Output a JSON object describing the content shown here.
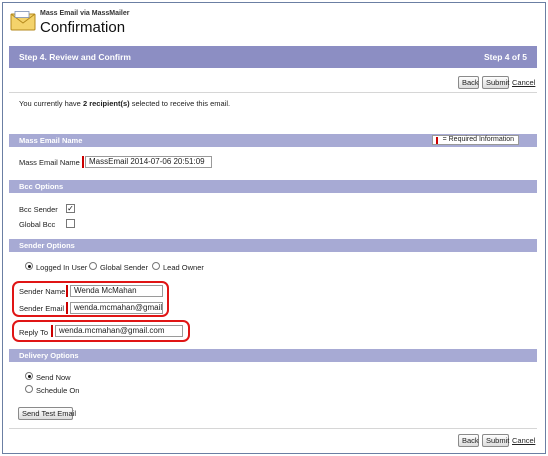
{
  "header": {
    "subtitle": "Mass Email via MassMailer",
    "title": "Confirmation",
    "icon": "envelope-icon"
  },
  "stepbar": {
    "title": "Step 4. Review and Confirm",
    "count": "Step 4 of 5"
  },
  "buttons": {
    "back": "Back",
    "submit": "Submit",
    "cancel": "Cancel",
    "send_test": "Send Test Email"
  },
  "info": {
    "prefix": "You currently have ",
    "count": "2 recipient(s)",
    "suffix": " selected to receive this email."
  },
  "sections": {
    "mass_email_name": "Mass Email Name",
    "required_info": "= Required Information",
    "bcc_options": "Bcc Options",
    "sender_options": "Sender Options",
    "delivery_options": "Delivery Options"
  },
  "mass_email": {
    "label": "Mass Email Name",
    "value": "MassEmail  2014-07-06 20:51:09"
  },
  "bcc": {
    "bcc_sender_label": "Bcc Sender",
    "bcc_sender_checked": "✓",
    "global_bcc_label": "Global Bcc"
  },
  "sender": {
    "options": [
      "Logged In User",
      "Global Sender",
      "Lead Owner"
    ],
    "selected": "Logged In User",
    "name_label": "Sender Name",
    "name_value": "Wenda McMahan",
    "email_label": "Sender Email",
    "email_value": "wenda.mcmahan@gmail.com",
    "reply_label": "Reply To",
    "reply_value": "wenda.mcmahan@gmail.com"
  },
  "delivery": {
    "options": [
      "Send Now",
      "Schedule On"
    ],
    "selected": "Send Now"
  },
  "colors": {
    "stepbar": "#8c8ec3",
    "section": "#a7aad4",
    "required": "#cc0000",
    "highlight": "#e01515"
  }
}
